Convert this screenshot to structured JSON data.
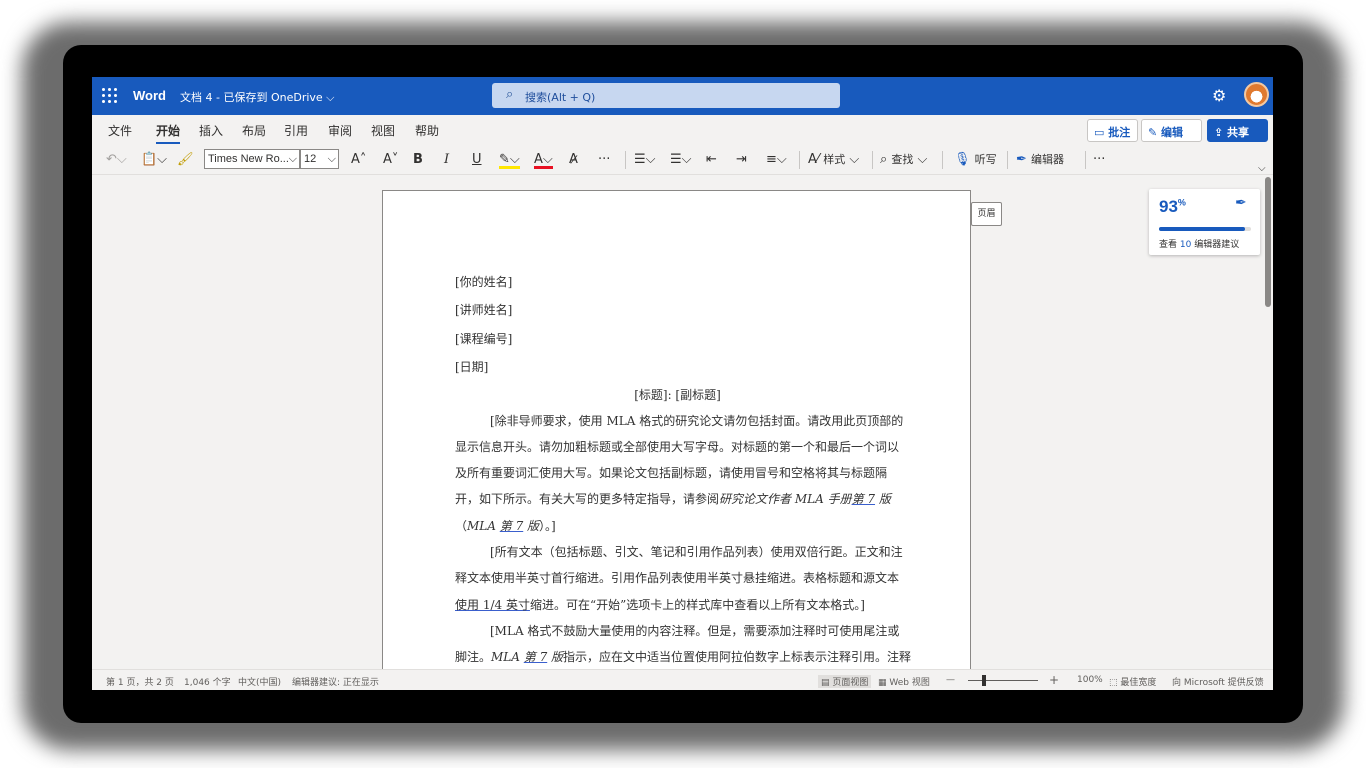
{
  "app": {
    "name": "Word",
    "doc_title": "文档 4 - 已保存到 OneDrive ⌵"
  },
  "search": {
    "placeholder": "搜索(Alt + Q)"
  },
  "menu": {
    "tabs": [
      "文件",
      "开始",
      "插入",
      "布局",
      "引用",
      "审阅",
      "视图",
      "帮助"
    ],
    "active": "开始"
  },
  "actions": {
    "comment": "批注",
    "edit": "编辑",
    "share": "共享"
  },
  "toolbar": {
    "font_name": "Times New Ro...",
    "font_size": "12",
    "grow": "A˄",
    "shrink": "A˅",
    "bold": "B",
    "italic": "I",
    "underline": "U",
    "styles_label": "样式",
    "find_label": "查找",
    "dictate_label": "听写",
    "editor_label": "编辑器",
    "more": "···"
  },
  "document": {
    "header_tag": "页眉",
    "lines": [
      "[你的姓名]",
      "[讲师姓名]",
      "[课程编号]",
      "[日期]",
      "[标题]: [副标题]",
      "[除非导师要求，使用 MLA 格式的研究论文请勿包括封面。请改用此页顶部的",
      "显示信息开头。请勿加粗标题或全部使用大写字母。对标题的第一个和最后一个词以",
      "及所有重要词汇使用大写。如果论文包括副标题，请使用冒号和空格将其与标题隔",
      "开，如下所示。有关大写的更多特定指导，请参阅",
      "研究论文作者 MLA 手册",
      "第 7",
      " 版",
      "（",
      "MLA",
      "第 7",
      " 版",
      "）。]",
      "[所有文本（包括标题、引文、笔记和引用作品列表）使用双倍行距。正文和注",
      "释文本使用半英寸首行缩进。引用作品列表使用半英寸悬挂缩进。表格标题和源文本",
      "使用 1/4 英寸",
      "缩进。可在“开始”选项卡上的样式库中查看以上所有文本格式。]",
      "[MLA 格式不鼓励大量使用的内容注释。但是，需要添加注释时可使用尾注或",
      "脚注。",
      "MLA",
      "第 7",
      " 版",
      "指示，应在文中适当位置使用阿拉伯数字上标表示注释引用。注释"
    ]
  },
  "editor_card": {
    "score": "93",
    "percent_sign": "%",
    "score_value": 0.93,
    "prefix": "查看 ",
    "count": "10",
    "suffix": " 编辑器建议"
  },
  "status": {
    "page": "第 1 页，共 2 页",
    "words": "1,046 个字",
    "lang": "中文(中国)",
    "editor": "编辑器建议: 正在显示",
    "print_view": "页面视图",
    "web_view": "Web 视图",
    "minus": "—",
    "plus": "+",
    "zoom": "100%",
    "best_fit": "最佳宽度",
    "feedback": "向 Microsoft 提供反馈"
  },
  "colors": {
    "brand": "#185abd",
    "background": "#f3f2f1"
  }
}
